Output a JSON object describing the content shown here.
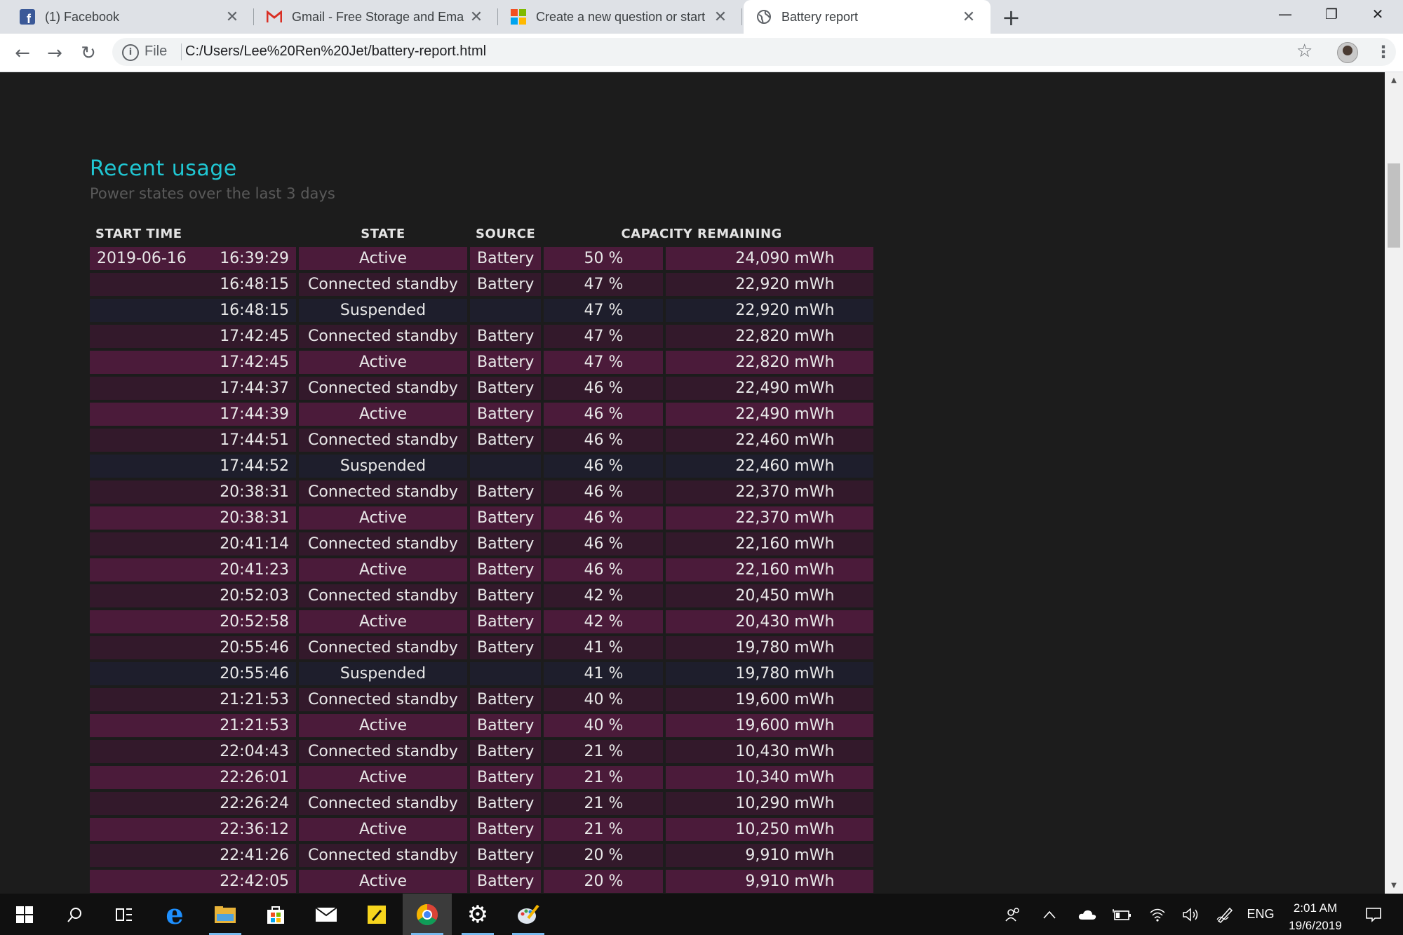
{
  "browser": {
    "tabs": [
      {
        "title": "(1) Facebook",
        "icon": "facebook-icon",
        "active": false
      },
      {
        "title": "Gmail - Free Storage and Email fr",
        "icon": "gmail-icon",
        "active": false
      },
      {
        "title": "Create a new question or start a",
        "icon": "microsoft-icon",
        "active": false
      },
      {
        "title": "Battery report",
        "icon": "globe-icon",
        "active": true
      }
    ],
    "address": {
      "scheme_label": "File",
      "url": "C:/Users/Lee%20Ren%20Jet/battery-report.html"
    }
  },
  "report": {
    "title": "Recent usage",
    "subtitle": "Power states over the last 3 days",
    "columns": [
      "START TIME",
      "STATE",
      "SOURCE",
      "CAPACITY REMAINING"
    ],
    "rows": [
      {
        "date": "2019-06-16",
        "time": "16:39:29",
        "state": "Active",
        "source": "Battery",
        "percent": "50 %",
        "capacity": "24,090 mWh"
      },
      {
        "date": "",
        "time": "16:48:15",
        "state": "Connected standby",
        "source": "Battery",
        "percent": "47 %",
        "capacity": "22,920 mWh"
      },
      {
        "date": "",
        "time": "16:48:15",
        "state": "Suspended",
        "source": "",
        "percent": "47 %",
        "capacity": "22,920 mWh"
      },
      {
        "date": "",
        "time": "17:42:45",
        "state": "Connected standby",
        "source": "Battery",
        "percent": "47 %",
        "capacity": "22,820 mWh"
      },
      {
        "date": "",
        "time": "17:42:45",
        "state": "Active",
        "source": "Battery",
        "percent": "47 %",
        "capacity": "22,820 mWh"
      },
      {
        "date": "",
        "time": "17:44:37",
        "state": "Connected standby",
        "source": "Battery",
        "percent": "46 %",
        "capacity": "22,490 mWh"
      },
      {
        "date": "",
        "time": "17:44:39",
        "state": "Active",
        "source": "Battery",
        "percent": "46 %",
        "capacity": "22,490 mWh"
      },
      {
        "date": "",
        "time": "17:44:51",
        "state": "Connected standby",
        "source": "Battery",
        "percent": "46 %",
        "capacity": "22,460 mWh"
      },
      {
        "date": "",
        "time": "17:44:52",
        "state": "Suspended",
        "source": "",
        "percent": "46 %",
        "capacity": "22,460 mWh"
      },
      {
        "date": "",
        "time": "20:38:31",
        "state": "Connected standby",
        "source": "Battery",
        "percent": "46 %",
        "capacity": "22,370 mWh"
      },
      {
        "date": "",
        "time": "20:38:31",
        "state": "Active",
        "source": "Battery",
        "percent": "46 %",
        "capacity": "22,370 mWh"
      },
      {
        "date": "",
        "time": "20:41:14",
        "state": "Connected standby",
        "source": "Battery",
        "percent": "46 %",
        "capacity": "22,160 mWh"
      },
      {
        "date": "",
        "time": "20:41:23",
        "state": "Active",
        "source": "Battery",
        "percent": "46 %",
        "capacity": "22,160 mWh"
      },
      {
        "date": "",
        "time": "20:52:03",
        "state": "Connected standby",
        "source": "Battery",
        "percent": "42 %",
        "capacity": "20,450 mWh"
      },
      {
        "date": "",
        "time": "20:52:58",
        "state": "Active",
        "source": "Battery",
        "percent": "42 %",
        "capacity": "20,430 mWh"
      },
      {
        "date": "",
        "time": "20:55:46",
        "state": "Connected standby",
        "source": "Battery",
        "percent": "41 %",
        "capacity": "19,780 mWh"
      },
      {
        "date": "",
        "time": "20:55:46",
        "state": "Suspended",
        "source": "",
        "percent": "41 %",
        "capacity": "19,780 mWh"
      },
      {
        "date": "",
        "time": "21:21:53",
        "state": "Connected standby",
        "source": "Battery",
        "percent": "40 %",
        "capacity": "19,600 mWh"
      },
      {
        "date": "",
        "time": "21:21:53",
        "state": "Active",
        "source": "Battery",
        "percent": "40 %",
        "capacity": "19,600 mWh"
      },
      {
        "date": "",
        "time": "22:04:43",
        "state": "Connected standby",
        "source": "Battery",
        "percent": "21 %",
        "capacity": "10,430 mWh"
      },
      {
        "date": "",
        "time": "22:26:01",
        "state": "Active",
        "source": "Battery",
        "percent": "21 %",
        "capacity": "10,340 mWh"
      },
      {
        "date": "",
        "time": "22:26:24",
        "state": "Connected standby",
        "source": "Battery",
        "percent": "21 %",
        "capacity": "10,290 mWh"
      },
      {
        "date": "",
        "time": "22:36:12",
        "state": "Active",
        "source": "Battery",
        "percent": "21 %",
        "capacity": "10,250 mWh"
      },
      {
        "date": "",
        "time": "22:41:26",
        "state": "Connected standby",
        "source": "Battery",
        "percent": "20 %",
        "capacity": "9,910 mWh"
      },
      {
        "date": "",
        "time": "22:42:05",
        "state": "Active",
        "source": "Battery",
        "percent": "20 %",
        "capacity": "9,910 mWh"
      }
    ]
  },
  "colors": {
    "title_accent": "#20c7d3",
    "row_active": "#4b1b3a",
    "row_connected_standby": "#33192b",
    "row_suspended": "#1e1e2c"
  },
  "taskbar": {
    "apps": [
      "start-icon",
      "search-icon",
      "task-view-icon",
      "edge-icon",
      "file-explorer-icon",
      "store-icon",
      "mail-icon",
      "sticky-notes-icon",
      "chrome-icon",
      "settings-icon",
      "paint-icon"
    ],
    "language": "ENG",
    "time": "2:01 AM",
    "date": "19/6/2019"
  }
}
